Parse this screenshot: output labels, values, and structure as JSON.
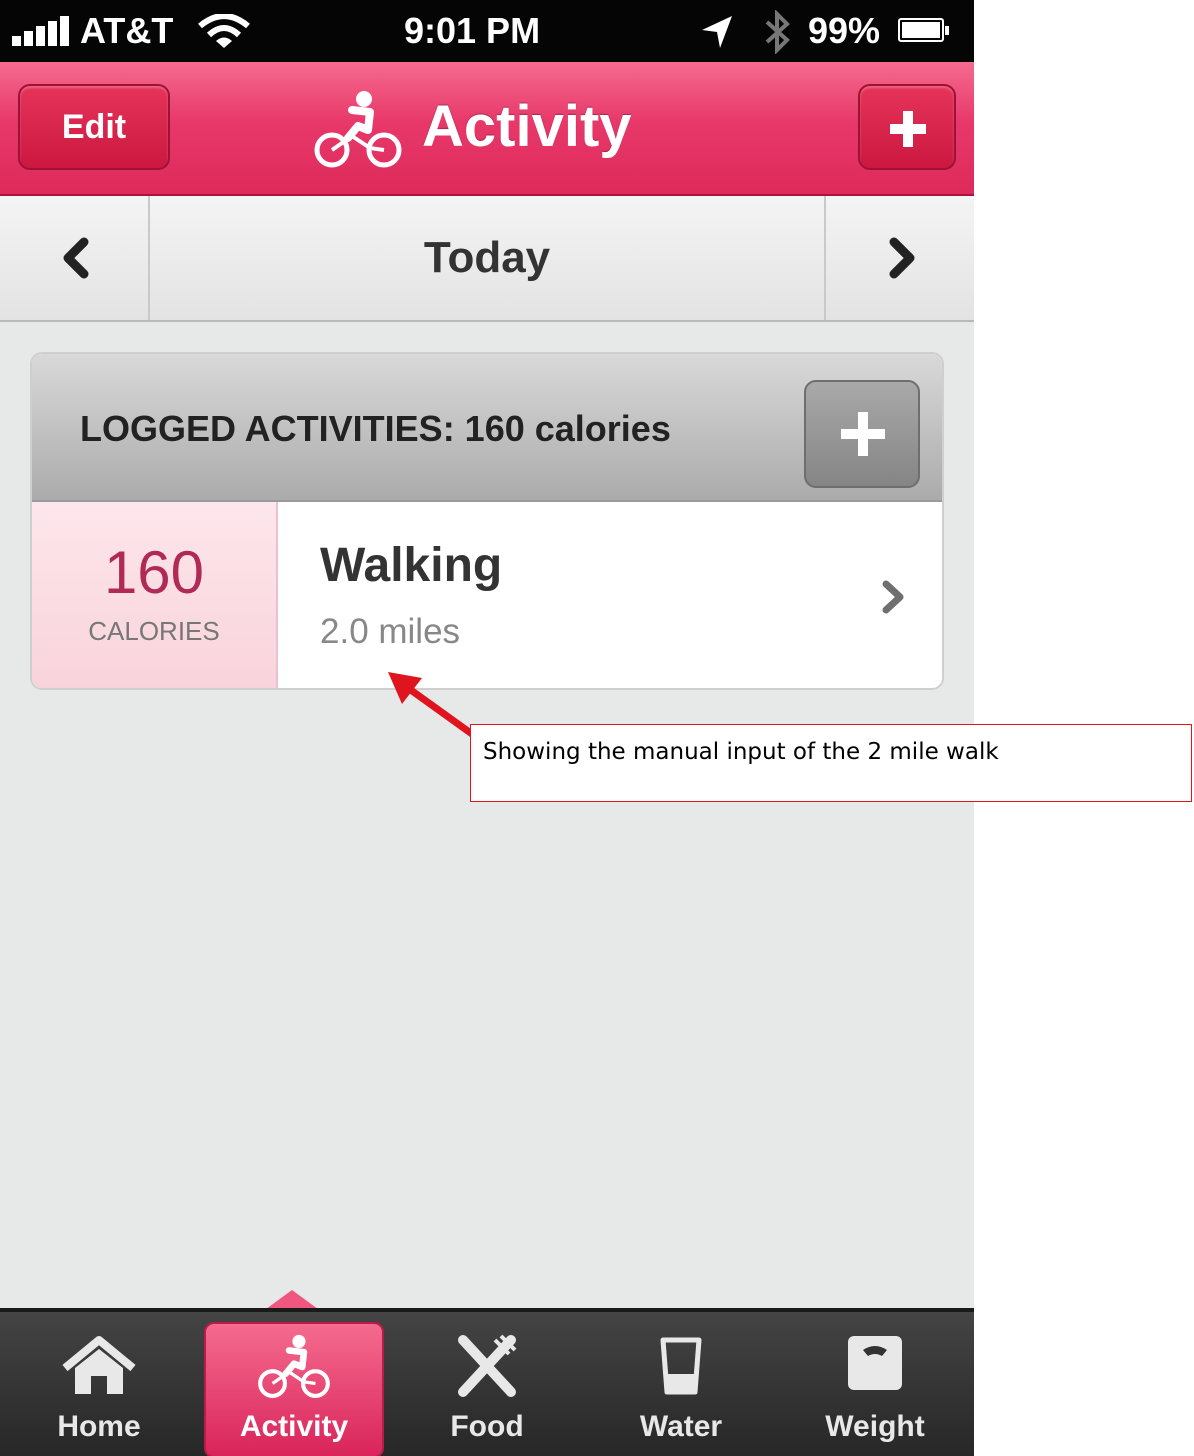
{
  "status_bar": {
    "carrier": "AT&T",
    "time": "9:01 PM",
    "battery": "99%",
    "signal_bars": 5,
    "icons": [
      "signal-icon",
      "wifi-icon",
      "location-icon",
      "bluetooth-icon",
      "battery-icon"
    ]
  },
  "nav_bar": {
    "edit_label": "Edit",
    "title": "Activity",
    "title_icon": "bike-icon",
    "add_icon": "plus-icon"
  },
  "date_bar": {
    "label": "Today",
    "prev_icon": "chevron-left-icon",
    "next_icon": "chevron-right-icon"
  },
  "activities_card": {
    "header": "LOGGED ACTIVITIES: 160 calories",
    "add_icon": "plus-icon",
    "items": [
      {
        "calories": "160",
        "calories_unit": "CALORIES",
        "name": "Walking",
        "detail": "2.0 miles"
      }
    ]
  },
  "annotation": {
    "text": "Showing the manual input of the 2 mile walk",
    "color": "#e0141e"
  },
  "tab_bar": {
    "active": "Activity",
    "tabs": [
      {
        "label": "Home",
        "icon": "home-icon"
      },
      {
        "label": "Activity",
        "icon": "bike-icon"
      },
      {
        "label": "Food",
        "icon": "fork-knife-icon"
      },
      {
        "label": "Water",
        "icon": "glass-icon"
      },
      {
        "label": "Weight",
        "icon": "scale-icon"
      }
    ]
  },
  "colors": {
    "accent": "#e8386a",
    "calories_text": "#b02a55"
  }
}
